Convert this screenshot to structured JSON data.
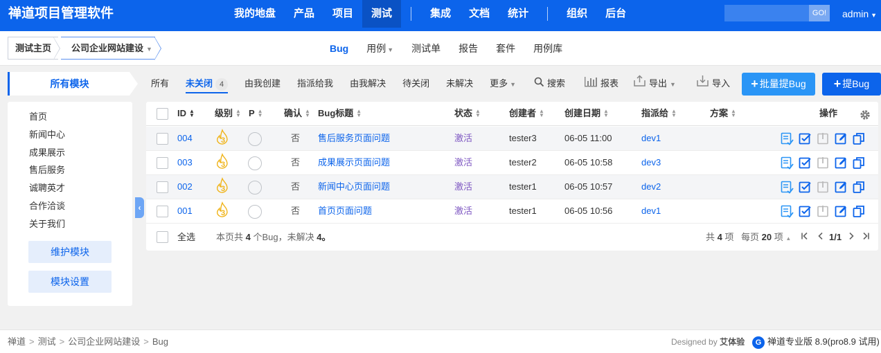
{
  "app": {
    "title": "禅道项目管理软件"
  },
  "main_nav": [
    {
      "label": "我的地盘"
    },
    {
      "label": "产品"
    },
    {
      "label": "项目"
    },
    {
      "label": "测试",
      "active": true
    },
    {
      "label": "集成"
    },
    {
      "label": "文档"
    },
    {
      "label": "统计"
    },
    {
      "label": "组织"
    },
    {
      "label": "后台"
    }
  ],
  "search": {
    "go_label": "GO!"
  },
  "user": {
    "name": "admin"
  },
  "breadcrumb": {
    "home": "测试主页",
    "product": "公司企业网站建设"
  },
  "sub_nav": [
    {
      "label": "Bug",
      "active": true
    },
    {
      "label": "用例",
      "dropdown": true
    },
    {
      "label": "测试单"
    },
    {
      "label": "报告"
    },
    {
      "label": "套件"
    },
    {
      "label": "用例库"
    }
  ],
  "sidebar": {
    "header": "所有模块",
    "modules": [
      "首页",
      "新闻中心",
      "成果展示",
      "售后服务",
      "诚聘英才",
      "合作洽谈",
      "关于我们"
    ],
    "maintain_button": "维护模块",
    "settings_button": "模块设置"
  },
  "filter_tabs": {
    "all": "所有",
    "unclosed": "未关闭",
    "unclosed_count": "4",
    "created_by_me": "由我创建",
    "assigned_to_me": "指派给我",
    "resolved_by_me": "由我解决",
    "to_close": "待关闭",
    "unresolved": "未解决",
    "more": "更多"
  },
  "tools": {
    "search": "搜索",
    "report": "报表",
    "export": "导出",
    "import": "导入",
    "batch_create": "批量提Bug",
    "create": "提Bug"
  },
  "table": {
    "headers": {
      "id": "ID",
      "severity": "级别",
      "priority": "P",
      "confirmed": "确认",
      "title": "Bug标题",
      "status": "状态",
      "creator": "创建者",
      "created_date": "创建日期",
      "assigned_to": "指派给",
      "resolution": "方案",
      "actions": "操作"
    },
    "rows": [
      {
        "id": "004",
        "severity": "3",
        "confirmed": "否",
        "title": "售后服务页面问题",
        "status": "激活",
        "creator": "tester3",
        "date": "06-05 11:00",
        "assigned": "dev1"
      },
      {
        "id": "003",
        "severity": "3",
        "confirmed": "否",
        "title": "成果展示页面问题",
        "status": "激活",
        "creator": "tester2",
        "date": "06-05 10:58",
        "assigned": "dev3"
      },
      {
        "id": "002",
        "severity": "3",
        "confirmed": "否",
        "title": "新闻中心页面问题",
        "status": "激活",
        "creator": "tester1",
        "date": "06-05 10:57",
        "assigned": "dev2"
      },
      {
        "id": "001",
        "severity": "3",
        "confirmed": "否",
        "title": "首页页面问题",
        "status": "激活",
        "creator": "tester1",
        "date": "06-05 10:56",
        "assigned": "dev1"
      }
    ],
    "footer": {
      "select_all": "全选",
      "summary_prefix": "本页共",
      "summary_count": "4",
      "summary_mid": "个Bug，未解决",
      "summary_unresolved": "4。",
      "total_prefix": "共",
      "total_count": "4",
      "total_suffix": "项",
      "per_page_prefix": "每页",
      "per_page": "20",
      "per_page_suffix": "项",
      "page_info": "1/1"
    }
  },
  "footer": {
    "crumbs": [
      "禅道",
      "测试",
      "公司企业网站建设",
      "Bug"
    ],
    "designed_by_prefix": "Designed by",
    "designed_by": "艾体验",
    "version": "禅道专业版 8.9(pro8.9 试用)"
  },
  "colors": {
    "primary": "#0c64eb",
    "batch_button": "#2a95f6",
    "status_active": "#7e57c2",
    "severity": "#f0b41a"
  }
}
